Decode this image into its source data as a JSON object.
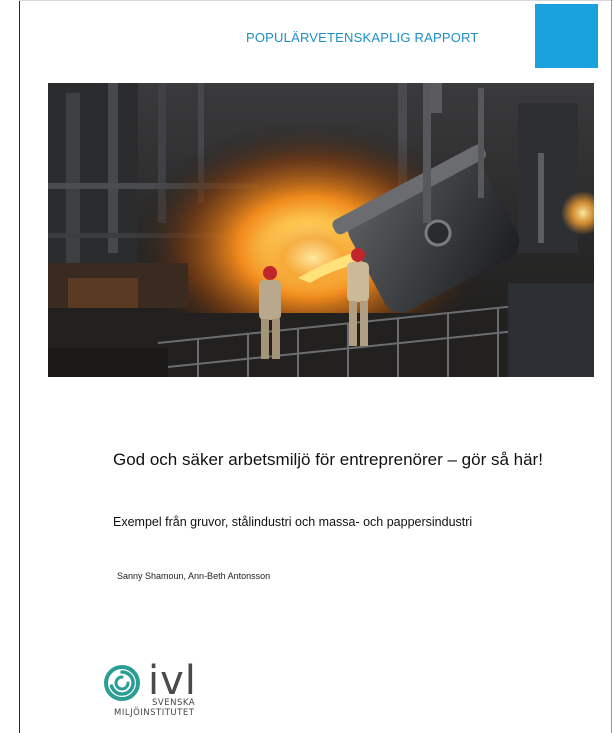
{
  "header": {
    "label": "POPULÄRVETENSKAPLIG RAPPORT",
    "accent_color": "#1aa2dc",
    "label_color": "#1b8fc6"
  },
  "hero_image": {
    "icon": "steel-foundry-photo",
    "description_alt": ""
  },
  "report": {
    "title": "God och säker arbetsmiljö för entreprenörer – gör så här!",
    "subtitle": "Exempel från gruvor, stålindustri och massa- och pappersindustri",
    "authors": "Sanny Shamoun, Ann-Beth Antonsson"
  },
  "logo": {
    "icon": "ivl-spiral-logo-icon",
    "wordmark": "ivl",
    "line1": "SVENSKA",
    "line2": "MILJÖINSTITUTET",
    "color": "#2a9d95"
  }
}
